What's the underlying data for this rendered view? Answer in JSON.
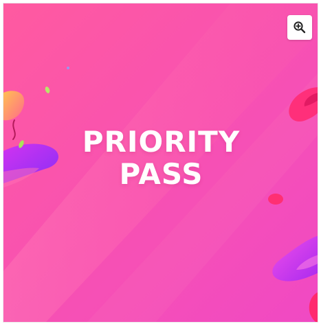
{
  "product_image": {
    "title_lines": [
      "PRIORITY",
      "PASS"
    ],
    "gradient_colors": [
      "#ff5a9e",
      "#f24fbf"
    ],
    "accent_colors": [
      "#c82ee6",
      "#ff2f7a",
      "#ffb14a",
      "#9b37ff"
    ]
  },
  "zoom_control": {
    "icon": "zoom-in-icon"
  }
}
